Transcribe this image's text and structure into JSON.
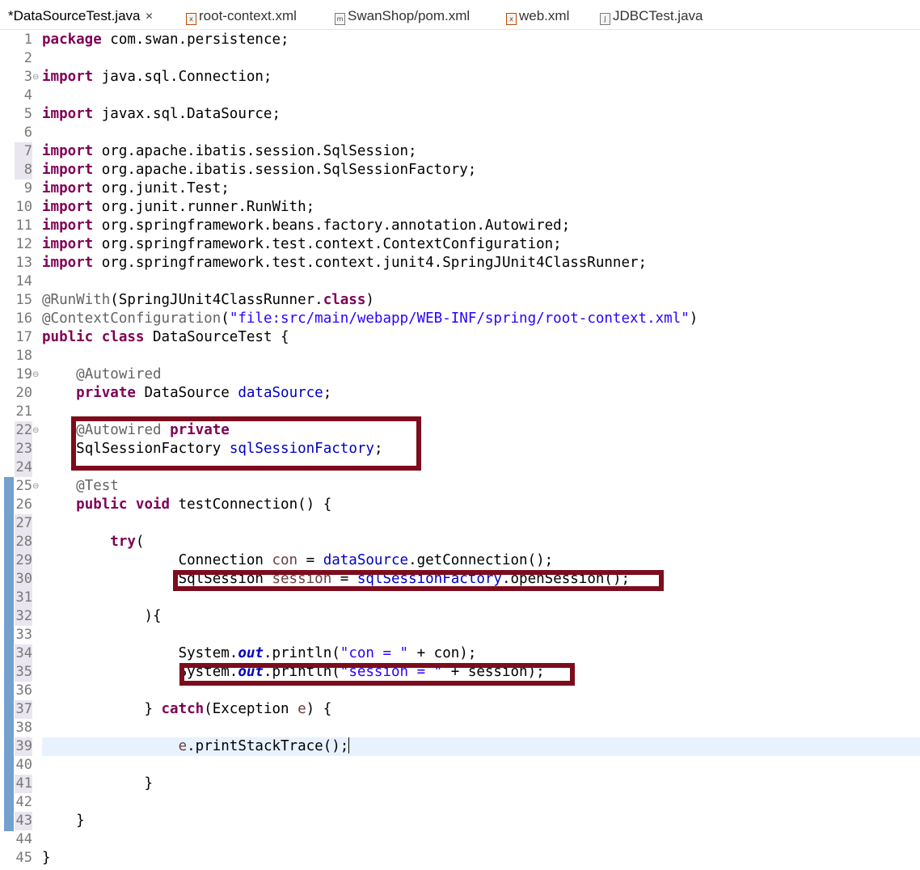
{
  "tabs": [
    {
      "label": "*DataSourceTest.java",
      "close": "✕",
      "icon": "java-file-icon"
    },
    {
      "label": "root-context.xml",
      "icon": "xml-file-icon"
    },
    {
      "label": "SwanShop/pom.xml",
      "icon": "maven-pom-icon"
    },
    {
      "label": "web.xml",
      "icon": "xml-file-icon"
    },
    {
      "label": "JDBCTest.java",
      "icon": "java-file-icon"
    }
  ],
  "line_numbers": [
    "1",
    "2",
    "3",
    "4",
    "5",
    "6",
    "7",
    "8",
    "9",
    "10",
    "11",
    "12",
    "13",
    "14",
    "15",
    "16",
    "17",
    "18",
    "19",
    "20",
    "21",
    "22",
    "23",
    "24",
    "25",
    "26",
    "27",
    "28",
    "29",
    "30",
    "31",
    "32",
    "33",
    "34",
    "35",
    "36",
    "37",
    "38",
    "39",
    "40",
    "41",
    "42",
    "43",
    "44",
    "45"
  ],
  "code": {
    "l1_kw": "package",
    "l1_rest": " com.swan.persistence;",
    "l3_kw": "import",
    "l3_rest": " java.sql.Connection;",
    "l5_kw": "import",
    "l5_rest": " javax.sql.DataSource;",
    "l7_kw": "import",
    "l7_rest": " org.apache.ibatis.session.SqlSession;",
    "l8_kw": "import",
    "l8_rest": " org.apache.ibatis.session.SqlSessionFactory;",
    "l9_kw": "import",
    "l9_rest": " org.junit.Test;",
    "l10_kw": "import",
    "l10_rest": " org.junit.runner.RunWith;",
    "l11_kw": "import",
    "l11_rest": " org.springframework.beans.factory.annotation.Autowired;",
    "l12_kw": "import",
    "l12_rest": " org.springframework.test.context.ContextConfiguration;",
    "l13_kw": "import",
    "l13_rest": " org.springframework.test.context.junit4.SpringJUnit4ClassRunner;",
    "l15_ann": "@RunWith",
    "l15_a": "(SpringJUnit4ClassRunner.",
    "l15_kw": "class",
    "l15_b": ")",
    "l16_ann": "@ContextConfiguration",
    "l16_a": "(",
    "l16_str": "\"file:src/main/webapp/WEB-INF/spring/root-context.xml\"",
    "l16_b": ")",
    "l17_kw1": "public",
    "l17_kw2": "class",
    "l17_rest": " DataSourceTest {",
    "l19_ann": "@Autowired",
    "l20_kw": "private",
    "l20_type": " DataSource ",
    "l20_fld": "dataSource",
    "l20_end": ";",
    "l22_ann": "@Autowired",
    "l22_kw": "private",
    "l23_type": "SqlSessionFactory ",
    "l23_fld": "sqlSessionFactory",
    "l23_end": ";",
    "l25_ann": "@Test",
    "l26_kw1": "public",
    "l26_kw2": "void",
    "l26_rest": " testConnection() {",
    "l28_kw": "try",
    "l28_rest": "(",
    "l29_type": "Connection ",
    "l29_var": "con",
    "l29_eq": " = ",
    "l29_fld": "dataSource",
    "l29_rest": ".getConnection();",
    "l30_type": "SqlSession ",
    "l30_var": "session",
    "l30_eq": " = ",
    "l30_fld": "sqlSessionFactory",
    "l30_rest": ".openSession();",
    "l32_rest": "){",
    "l34_a": "System.",
    "l34_sfld": "out",
    "l34_b": ".println(",
    "l34_str": "\"con = \"",
    "l34_c": " + con);",
    "l35_a": "System.",
    "l35_sfld": "out",
    "l35_b": ".println(",
    "l35_str": "\"session = \"",
    "l35_c": " + session);",
    "l37_a": "} ",
    "l37_kw": "catch",
    "l37_b": "(Exception ",
    "l37_var": "e",
    "l37_c": ") {",
    "l39_var": "e",
    "l39_rest": ".printStackTrace();",
    "l41": "}",
    "l43": "}",
    "l45": "}"
  }
}
